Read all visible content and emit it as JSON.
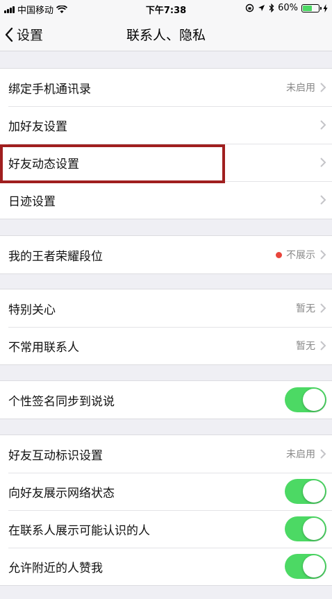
{
  "status_bar": {
    "carrier": "中国移动",
    "time": "下午7:38",
    "battery": "60%",
    "battery_level": 0.6
  },
  "nav": {
    "back_label": "设置",
    "title": "联系人、隐私"
  },
  "groups": [
    {
      "rows": [
        {
          "label": "绑定手机通讯录",
          "value": "未启用",
          "control": "chevron"
        },
        {
          "label": "加好友设置",
          "value": "",
          "control": "chevron"
        },
        {
          "label": "好友动态设置",
          "value": "",
          "control": "chevron"
        },
        {
          "label": "日迹设置",
          "value": "",
          "control": "chevron"
        }
      ]
    },
    {
      "rows": [
        {
          "label": "我的王者荣耀段位",
          "value": "不展示",
          "control": "chevron",
          "dot": true
        }
      ]
    },
    {
      "rows": [
        {
          "label": "特别关心",
          "value": "暂无",
          "control": "chevron"
        },
        {
          "label": "不常用联系人",
          "value": "暂无",
          "control": "chevron"
        }
      ]
    },
    {
      "rows": [
        {
          "label": "个性签名同步到说说",
          "value": "",
          "control": "toggle",
          "on": true
        }
      ]
    },
    {
      "rows": [
        {
          "label": "好友互动标识设置",
          "value": "未启用",
          "control": "chevron"
        },
        {
          "label": "向好友展示网络状态",
          "value": "",
          "control": "toggle",
          "on": true
        },
        {
          "label": "在联系人展示可能认识的人",
          "value": "",
          "control": "toggle",
          "on": true
        },
        {
          "label": "允许附近的人赞我",
          "value": "",
          "control": "toggle",
          "on": true
        }
      ]
    }
  ],
  "colors": {
    "toggle_on": "#4cd964",
    "highlight_border": "#a01f1f",
    "status_dot": "#e8453c"
  }
}
